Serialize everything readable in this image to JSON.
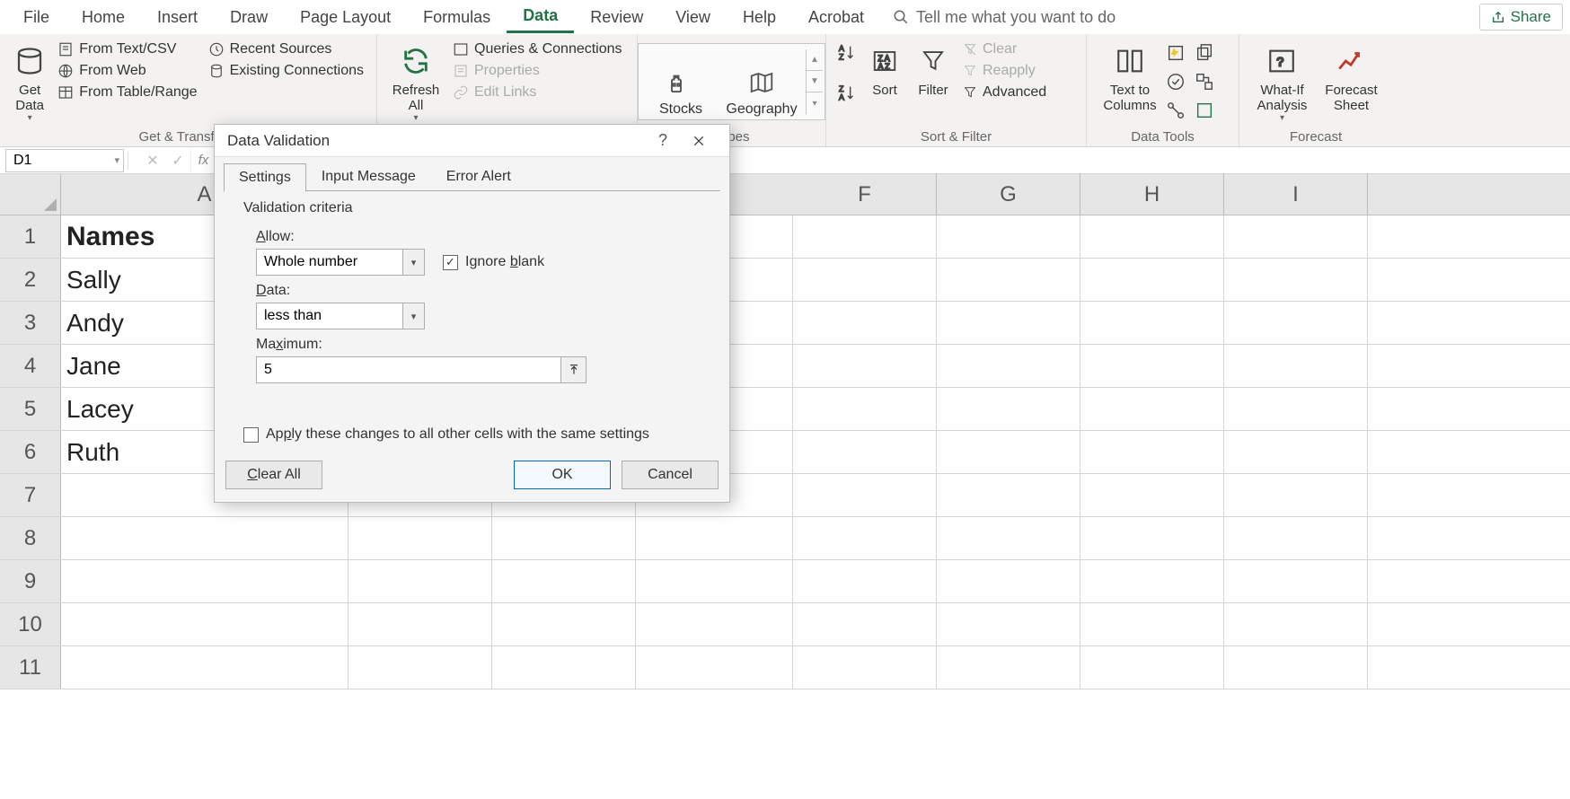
{
  "menubar": {
    "items": [
      "File",
      "Home",
      "Insert",
      "Draw",
      "Page Layout",
      "Formulas",
      "Data",
      "Review",
      "View",
      "Help",
      "Acrobat"
    ],
    "active_index": 6,
    "tell_me": "Tell me what you want to do",
    "share": "Share"
  },
  "ribbon": {
    "get_transform": {
      "get_data": "Get Data",
      "from_text": "From Text/CSV",
      "from_web": "From Web",
      "from_table": "From Table/Range",
      "recent": "Recent Sources",
      "existing": "Existing Connections",
      "group_label": "Get & Transform"
    },
    "queries": {
      "refresh": "Refresh All",
      "queries_conn": "Queries & Connections",
      "properties": "Properties",
      "edit_links": "Edit Links"
    },
    "data_types": {
      "stocks": "Stocks",
      "geography": "Geography",
      "group_label": "Types"
    },
    "sort_filter": {
      "sort": "Sort",
      "filter": "Filter",
      "clear": "Clear",
      "reapply": "Reapply",
      "advanced": "Advanced",
      "group_label": "Sort & Filter"
    },
    "data_tools": {
      "text_to_cols": "Text to Columns",
      "group_label": "Data Tools"
    },
    "forecast": {
      "whatif": "What-If Analysis",
      "forecast_sheet": "Forecast Sheet",
      "group_label": "Forecast"
    }
  },
  "namebox": {
    "ref": "D1"
  },
  "grid": {
    "columns": [
      "A",
      "F",
      "G",
      "H",
      "I"
    ],
    "col_widths": {
      "A": 320,
      "gap": 495,
      "std": 160
    },
    "rows": [
      {
        "n": "1",
        "A": "Names",
        "header": true
      },
      {
        "n": "2",
        "A": "Sally"
      },
      {
        "n": "3",
        "A": "Andy"
      },
      {
        "n": "4",
        "A": "Jane"
      },
      {
        "n": "5",
        "A": "Lacey"
      },
      {
        "n": "6",
        "A": "Ruth"
      },
      {
        "n": "7",
        "A": ""
      },
      {
        "n": "8",
        "A": ""
      },
      {
        "n": "9",
        "A": ""
      },
      {
        "n": "10",
        "A": ""
      },
      {
        "n": "11",
        "A": ""
      }
    ]
  },
  "dialog": {
    "title": "Data Validation",
    "tabs": [
      "Settings",
      "Input Message",
      "Error Alert"
    ],
    "active_tab": 0,
    "section": "Validation criteria",
    "allow_label": "Allow:",
    "allow_value": "Whole number",
    "ignore_blank": "Ignore blank",
    "ignore_blank_checked": true,
    "data_label": "Data:",
    "data_value": "less than",
    "max_label": "Maximum:",
    "max_value": "5",
    "apply_all": "Apply these changes to all other cells with the same settings",
    "apply_all_checked": false,
    "clear_all": "Clear All",
    "ok": "OK",
    "cancel": "Cancel"
  }
}
